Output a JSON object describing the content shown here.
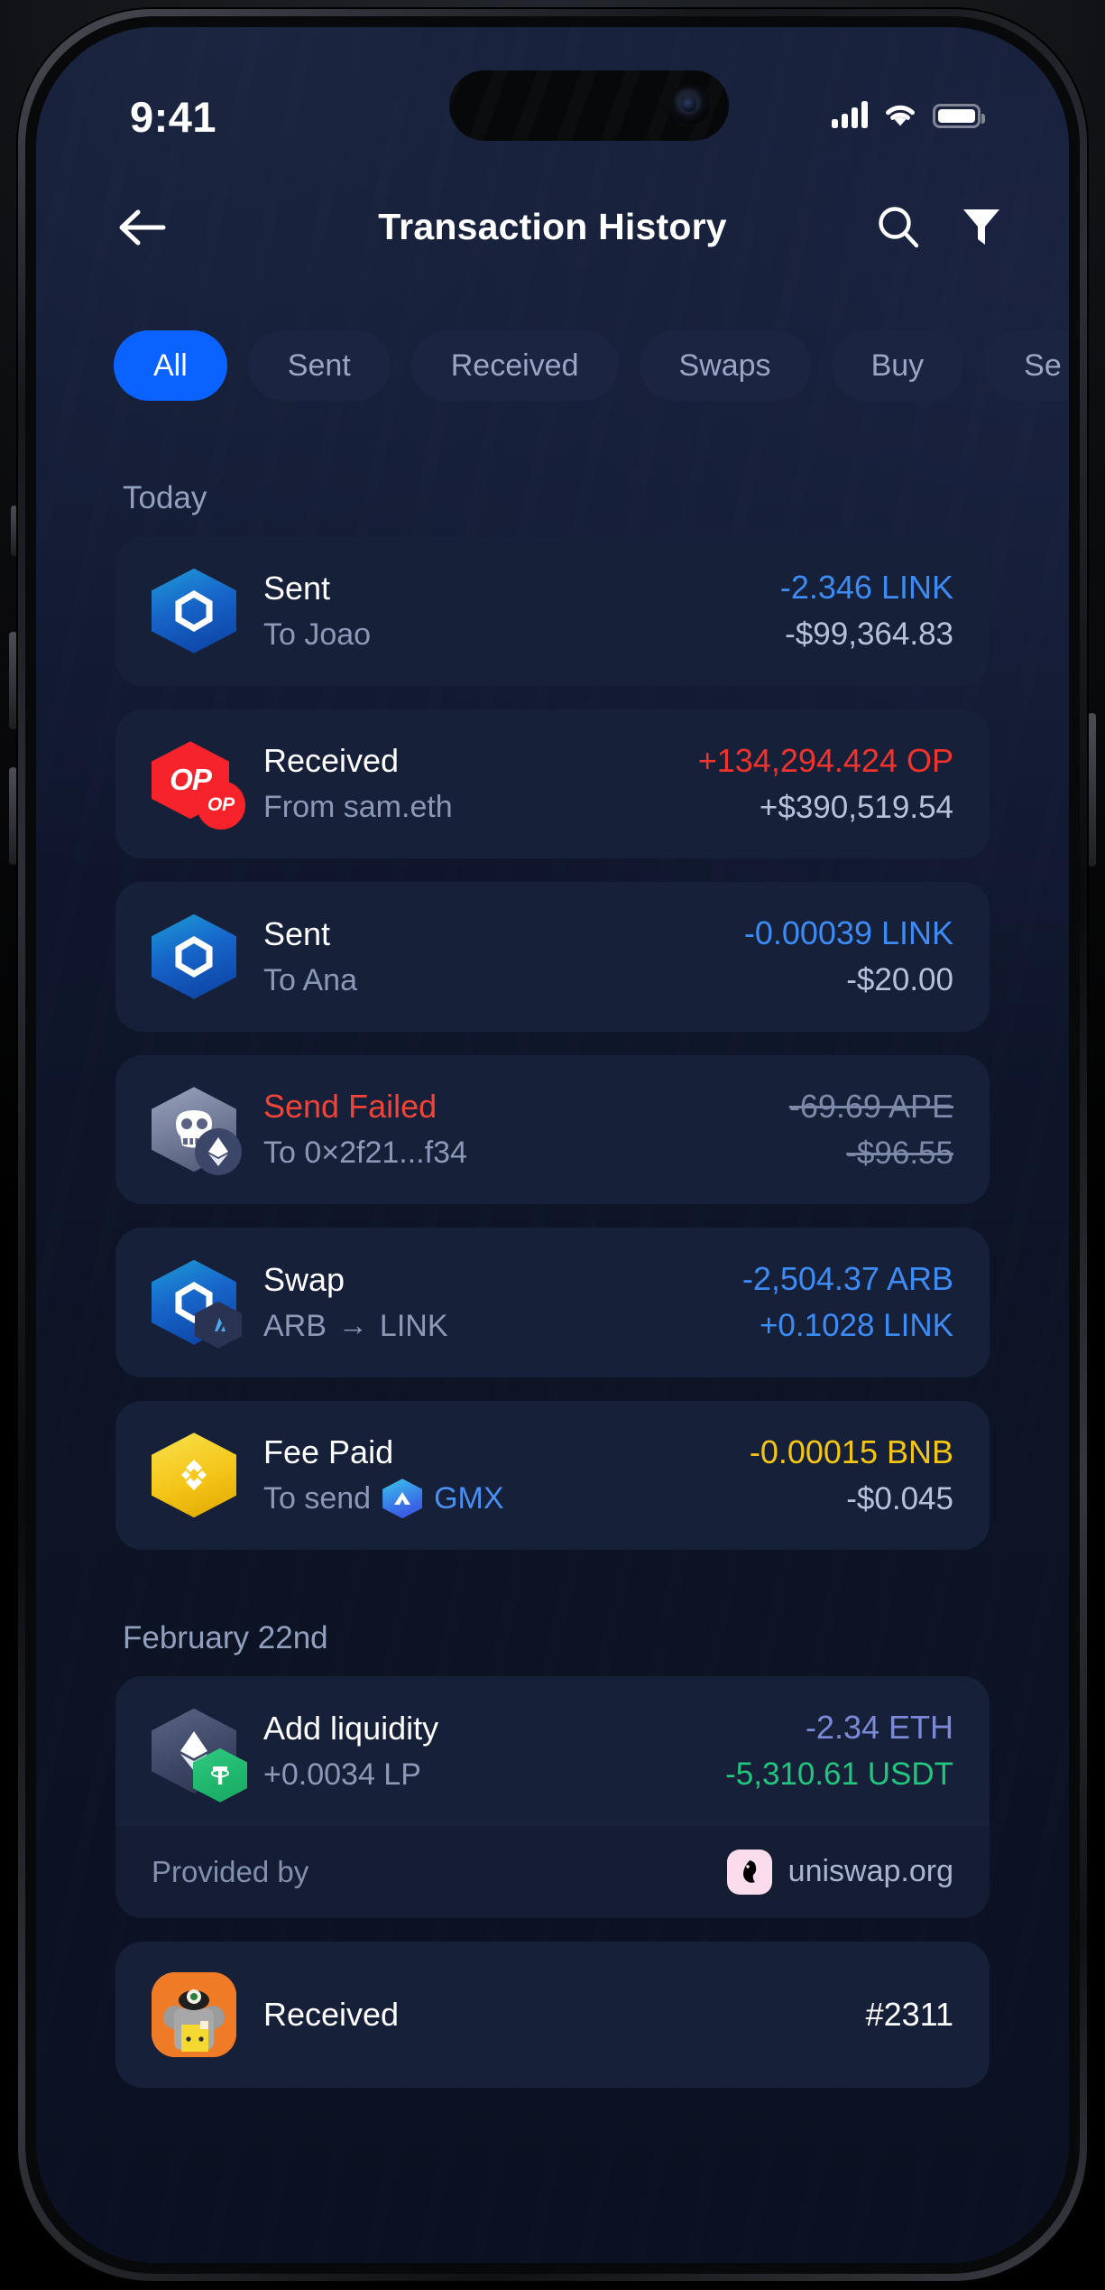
{
  "status_bar": {
    "time": "9:41",
    "signal_icon": "signal-bars-icon",
    "wifi_icon": "wifi-icon",
    "battery_icon": "battery-full-icon"
  },
  "header": {
    "back_icon": "back-arrow-icon",
    "title": "Transaction History",
    "search_icon": "search-icon",
    "filter_icon": "filter-funnel-icon"
  },
  "filters": {
    "chips": [
      {
        "label": "All",
        "active": true
      },
      {
        "label": "Sent",
        "active": false
      },
      {
        "label": "Received",
        "active": false
      },
      {
        "label": "Swaps",
        "active": false
      },
      {
        "label": "Buy",
        "active": false
      },
      {
        "label": "Se",
        "active": false
      }
    ]
  },
  "sections": [
    {
      "title": "Today",
      "items": [
        {
          "icon": "chainlink-token-icon",
          "title": "Sent",
          "subtitle": "To Joao",
          "amount": "-2.346 LINK",
          "amount_color": "#3d8bf5",
          "value": "-$99,364.83",
          "value_color": "#b6c1da"
        },
        {
          "icon": "optimism-token-icon",
          "title": "Received",
          "subtitle": "From sam.eth",
          "amount": "+134,294.424 OP",
          "amount_color": "#f0332c",
          "value": "+$390,519.54",
          "value_color": "#b6c1da"
        },
        {
          "icon": "chainlink-token-icon",
          "title": "Sent",
          "subtitle": "To Ana",
          "amount": "-0.00039 LINK",
          "amount_color": "#3d8bf5",
          "value": "-$20.00",
          "value_color": "#b6c1da"
        },
        {
          "icon": "apecoin-token-icon",
          "title": "Send Failed",
          "subtitle": "To 0×2f21...f34",
          "amount": "-69.69 APE",
          "amount_color": "#7c89a8",
          "value": "-$96.55",
          "value_color": "#7c89a8",
          "failed": true
        },
        {
          "icon": "chainlink-arbitrum-swap-icon",
          "title": "Swap",
          "subtitle_from": "ARB",
          "subtitle_arrow": "→",
          "subtitle_to": "LINK",
          "amount": "-2,504.37 ARB",
          "amount_color": "#3d8bf5",
          "value": "+0.1028 LINK",
          "value_color": "#3d8bf5"
        },
        {
          "icon": "bnb-token-icon",
          "title": "Fee Paid",
          "subtitle": "To send",
          "badge_label": "GMX",
          "badge_icon": "gmx-token-icon",
          "amount": "-0.00015 BNB",
          "amount_color": "#f3c515",
          "value": "-$0.045",
          "value_color": "#b6c1da"
        }
      ]
    },
    {
      "title": "February 22nd",
      "items": [
        {
          "icon": "eth-usdt-pair-icon",
          "title": "Add liquidity",
          "subtitle": "+0.0034 LP",
          "amount": "-2.34 ETH",
          "amount_color": "#7b8ad6",
          "value": "-5,310.61 USDT",
          "value_color": "#21c57e",
          "footer": {
            "label": "Provided by",
            "provider": "uniswap.org",
            "provider_icon": "uniswap-icon"
          }
        },
        {
          "icon": "nft-avatar-icon",
          "title": "Received",
          "subtitle": "",
          "amount": "#2311",
          "amount_color": "#ffffff",
          "value": ""
        }
      ]
    }
  ],
  "theme": {
    "accent": "#0b63ff",
    "page_bg": "#0d1426",
    "card_bg": "#172039"
  }
}
